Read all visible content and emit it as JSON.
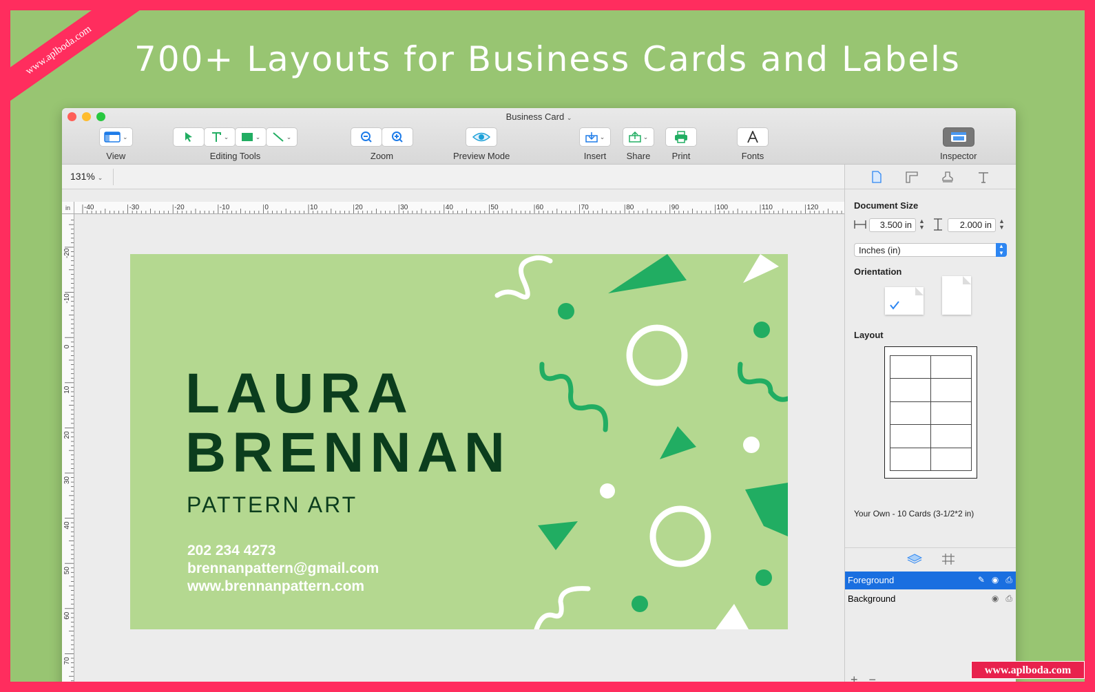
{
  "banner": {
    "headline": "700+ Layouts for Business Cards and Labels",
    "ribbon_text": "www.aplboda.com",
    "watermark": "www.aplboda.com"
  },
  "window": {
    "title": "Business Card",
    "traffic_light_colors": {
      "close": "#fe5f57",
      "minimize": "#febc2e",
      "zoom": "#28c840"
    }
  },
  "toolbar": {
    "view": "View",
    "editing_tools": "Editing Tools",
    "zoom": "Zoom",
    "preview_mode": "Preview Mode",
    "insert": "Insert",
    "share": "Share",
    "print": "Print",
    "fonts": "Fonts",
    "inspector": "Inspector"
  },
  "zoom_level": "131%",
  "rulers": {
    "unit": "in",
    "h_ticks": [
      "-40",
      "-30",
      "-20",
      "-10",
      "0",
      "10",
      "20",
      "30",
      "40",
      "50",
      "60",
      "70",
      "80",
      "90",
      "100",
      "110",
      "120"
    ],
    "v_ticks": [
      "-20",
      "-10",
      "0",
      "10",
      "20",
      "30",
      "40",
      "50",
      "60",
      "70"
    ]
  },
  "card": {
    "name_line1": "LAURA",
    "name_line2": "BRENNAN",
    "tagline": "PATTERN ART",
    "phone": "202 234 4273",
    "email": "brennanpattern@gmail.com",
    "website": "www.brennanpattern.com",
    "colors": {
      "background": "#b4d890",
      "name": "#0b3d1d",
      "accent": "#21ad62",
      "white": "#ffffff"
    }
  },
  "inspector": {
    "document_size_label": "Document Size",
    "width": "3.500 in",
    "height": "2.000 in",
    "units": "Inches (in)",
    "orientation_label": "Orientation",
    "layout_label": "Layout",
    "layout_caption": "Your Own - 10 Cards (3-1/2*2 in)",
    "layers": [
      {
        "name": "Foreground",
        "selected": true
      },
      {
        "name": "Background",
        "selected": false
      }
    ],
    "accent_color": "#1a6fe0"
  }
}
